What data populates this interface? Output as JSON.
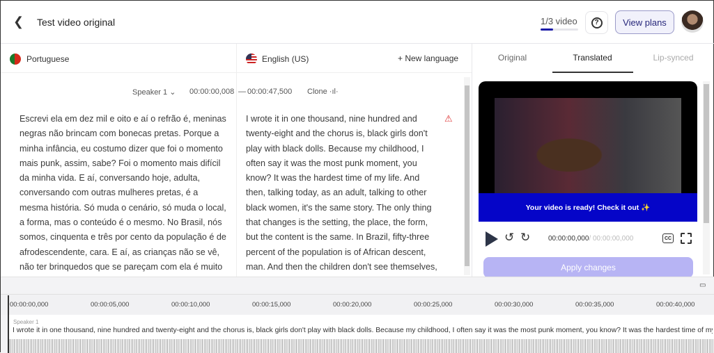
{
  "header": {
    "title": "Test video original",
    "quota": "1/3 video",
    "quota_fraction": 0.33,
    "help": "?",
    "view_plans": "View plans"
  },
  "languages": {
    "source": "Portuguese",
    "target": "English (US)",
    "new_language": "+ New language"
  },
  "segment": {
    "speaker": "Speaker 1 ⌄",
    "start": "00:00:00,008",
    "sep": "—",
    "end": "00:00:47,500",
    "clone": "Clone ·ıl·"
  },
  "source_text": "Escrevi ela em dez mil e oito e aí o refrão é, meninas negras não brincam com bonecas pretas. Porque a minha infância, eu costumo dizer que foi o momento mais punk, assim, sabe? Foi o momento mais difícil da minha vida. E aí, conversando hoje, adulta, conversando com outras mulheres pretas, é a mesma história. Só muda o cenário, só muda o local, a forma, mas o conteúdo é o mesmo. No Brasil, nós somos, cinquenta e três por cento da população é de afrodescendente, cara. E aí, as crianças não se vê, não ter brinquedos que se pareçam com ela é muito grave. E o mais grave é elas não perceberem",
  "target_text": "I wrote it in one thousand, nine hundred and twenty-eight and the chorus is, black girls don't play with black dolls. Because my childhood, I often say it was the most punk moment, you know? It was the hardest time of my life. And then, talking today, as an adult, talking to other black women, it's the same story. The only thing that changes is the setting, the place, the form, but the content is the same. In Brazil, fifty-three percent of the population is of African descent, man. And then the children don't see themselves, not having toys that look like them is",
  "tabs": [
    "Original",
    "Translated",
    "Lip-synced"
  ],
  "player": {
    "banner": "Your video is ready! Check it out ✨",
    "current": "00:00:00,000",
    "duration": "/ 00:00:00,000",
    "cc": "CC",
    "apply": "Apply changes"
  },
  "timeline": {
    "ticks": [
      "00:00:00,000",
      "00:00:05,000",
      "00:00:10,000",
      "00:00:15,000",
      "00:00:20,000",
      "00:00:25,000",
      "00:00:30,000",
      "00:00:35,000",
      "00:00:40,000"
    ],
    "speaker": "Speaker 1",
    "text": "I wrote it in one thousand, nine hundred and twenty-eight and the chorus is, black girls don't play with black dolls. Because my childhood, I often say it was the most punk moment, you know? It was the hardest time of my life. And then, talking today, as an adult"
  }
}
